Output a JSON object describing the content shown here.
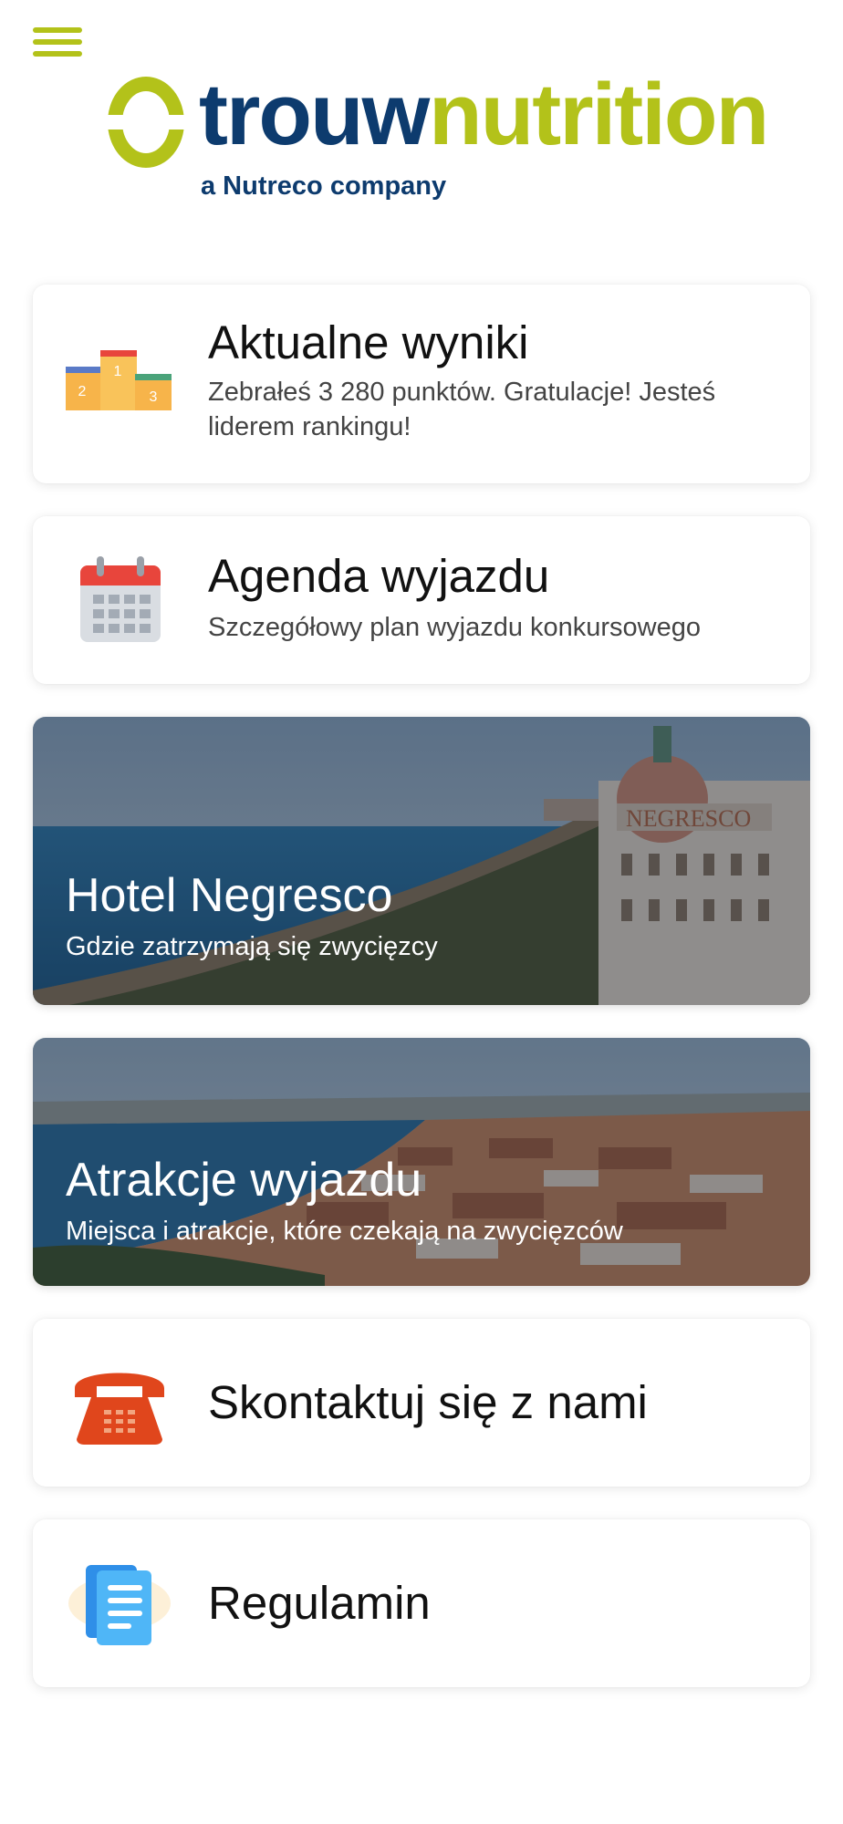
{
  "header": {
    "menu_icon": "hamburger-menu-icon",
    "logo": {
      "word1": "trouw",
      "word2": "nutrition",
      "tagline": "a Nutreco company",
      "colors": {
        "navy": "#0d3b6e",
        "lime": "#b3c21a"
      }
    }
  },
  "cards": {
    "results": {
      "icon": "podium-icon",
      "podium_labels": [
        "1",
        "2",
        "3"
      ],
      "title": "Aktualne wyniki",
      "subtitle": "Zebrałeś 3 280 punktów. Gratulacje! Jesteś liderem rankingu!"
    },
    "agenda": {
      "icon": "calendar-icon",
      "title": "Agenda wyjazdu",
      "subtitle": "Szczegółowy plan wyjazdu konkursowego"
    },
    "hotel": {
      "image": "hotel-negresco-photo",
      "sign_text": "NEGRESCO",
      "title": "Hotel Negresco",
      "subtitle": "Gdzie zatrzymają się zwycięzcy"
    },
    "attractions": {
      "image": "nice-city-panorama-photo",
      "title": "Atrakcje wyjazdu",
      "subtitle": "Miejsca i atrakcje, które czekają na zwycięzców"
    },
    "contact": {
      "icon": "telephone-icon",
      "title": "Skontaktuj się z nami"
    },
    "rules": {
      "icon": "document-icon",
      "title": "Regulamin"
    }
  },
  "colors": {
    "accent": "#b3c21a",
    "text": "#111111",
    "phone": "#e0461c",
    "calendar_red": "#e8453c",
    "document_blue": "#2f8fe8"
  }
}
